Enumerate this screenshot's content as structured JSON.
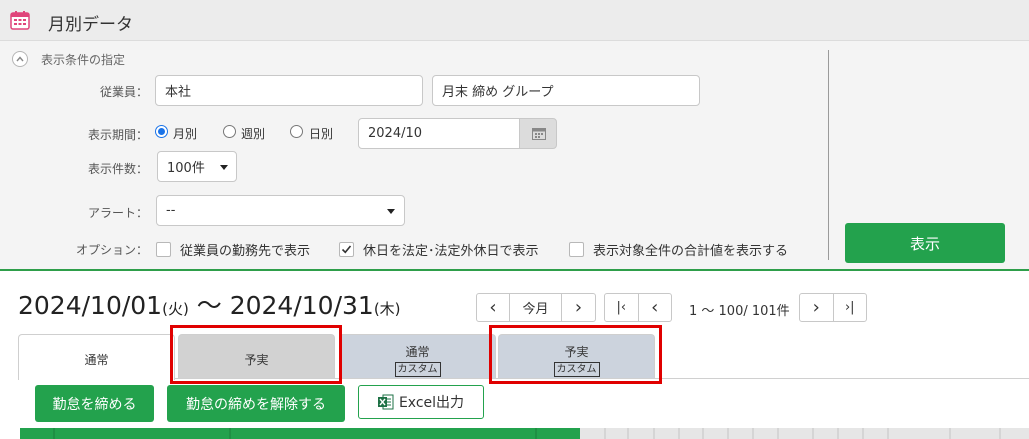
{
  "app": {
    "title": "月別データ"
  },
  "conditions": {
    "title": "表示条件の指定",
    "employee_label": "従業員：",
    "employee_value": "本社",
    "group_value": "月末 締め グループ",
    "period_label": "表示期間：",
    "period_options": [
      "月別",
      "週別",
      "日別"
    ],
    "period_selected": "月別",
    "period_value": "2024/10",
    "count_label": "表示件数：",
    "count_value": "100件",
    "alert_label": "アラート：",
    "alert_value": "--",
    "option_label": "オプション：",
    "options": [
      {
        "label": "従業員の勤務先で表示",
        "checked": false
      },
      {
        "label": "休日を法定･法定外休日で表示",
        "checked": true
      },
      {
        "label": "表示対象全件の合計値を表示する",
        "checked": false
      }
    ],
    "show_button": "表示"
  },
  "range": {
    "start": "2024/10/01",
    "start_day": "(火)",
    "sep": " ～ ",
    "end": "2024/10/31",
    "end_day": "(木)"
  },
  "nav": {
    "prev": "‹",
    "today": "今月",
    "next": "›",
    "first": "|‹",
    "prev_page": "‹",
    "count_text": "1 ～ 100/ 101件",
    "next_page": "›",
    "last": "›|"
  },
  "tabs": [
    {
      "label": "通常",
      "tag": ""
    },
    {
      "label": "予実",
      "tag": ""
    },
    {
      "label": "通常",
      "tag": "カスタム"
    },
    {
      "label": "予実",
      "tag": "カスタム"
    }
  ],
  "actions": {
    "close_button": "勤怠を締める",
    "unclose_button": "勤怠の締めを解除する",
    "excel_button": "Excel出力"
  },
  "colors": {
    "accent": "#23a24d",
    "highlight": "#e00000"
  }
}
